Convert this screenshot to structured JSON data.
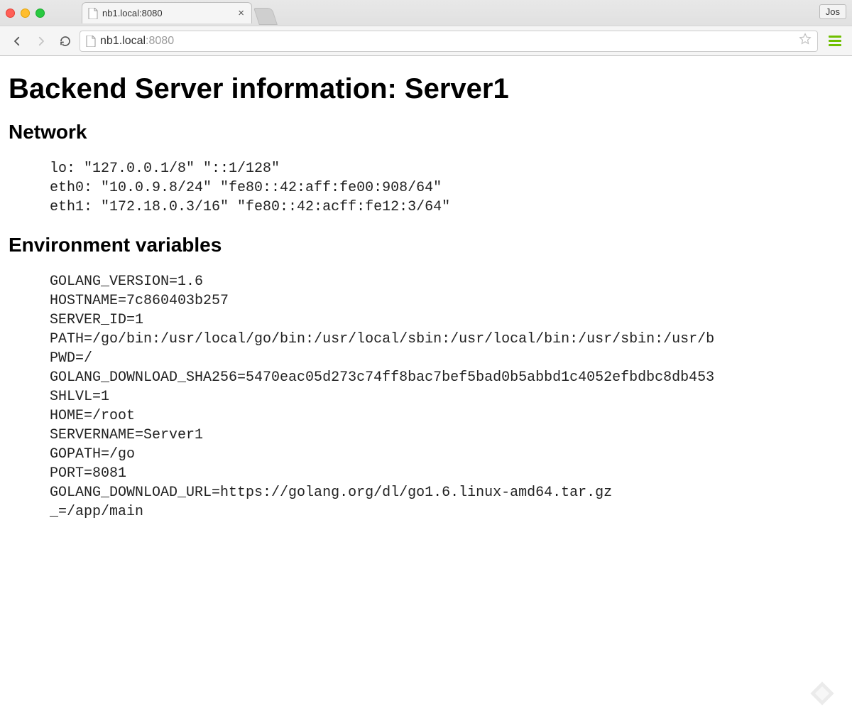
{
  "browser": {
    "user_label": "Jos",
    "tab_title": "nb1.local:8080",
    "url_host": "nb1.local",
    "url_port": ":8080"
  },
  "page": {
    "h1": "Backend Server information: Server1",
    "network_heading": "Network",
    "env_heading": "Environment variables",
    "network_lines": [
      "lo: \"127.0.0.1/8\" \"::1/128\"",
      "eth0: \"10.0.9.8/24\" \"fe80::42:aff:fe00:908/64\"",
      "eth1: \"172.18.0.3/16\" \"fe80::42:acff:fe12:3/64\""
    ],
    "env_lines": [
      "GOLANG_VERSION=1.6",
      "HOSTNAME=7c860403b257",
      "SERVER_ID=1",
      "PATH=/go/bin:/usr/local/go/bin:/usr/local/sbin:/usr/local/bin:/usr/sbin:/usr/b",
      "PWD=/",
      "GOLANG_DOWNLOAD_SHA256=5470eac05d273c74ff8bac7bef5bad0b5abbd1c4052efbdbc8db453",
      "SHLVL=1",
      "HOME=/root",
      "SERVERNAME=Server1",
      "GOPATH=/go",
      "PORT=8081",
      "GOLANG_DOWNLOAD_URL=https://golang.org/dl/go1.6.linux-amd64.tar.gz",
      "_=/app/main"
    ]
  }
}
